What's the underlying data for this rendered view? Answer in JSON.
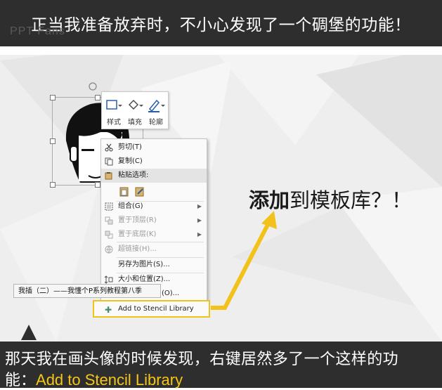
{
  "top_banner": {
    "title": "正当我准备放弃时，不小心发现了一个碉堡的功能！",
    "watermark": "PPT Fans"
  },
  "mini_toolbar": {
    "items": [
      {
        "label": "样式",
        "icon": "style-icon"
      },
      {
        "label": "填充",
        "icon": "fill-bucket-icon"
      },
      {
        "label": "轮廓",
        "icon": "outline-pen-icon"
      }
    ]
  },
  "context_menu": {
    "items": [
      {
        "label": "剪切(T)",
        "icon": "scissors-icon",
        "disabled": false
      },
      {
        "label": "复制(C)",
        "icon": "copy-icon",
        "disabled": false
      },
      {
        "label": "粘贴选项:",
        "icon": "paste-icon",
        "disabled": false,
        "header": true
      },
      {
        "label": "组合(G)",
        "icon": "group-icon",
        "disabled": false,
        "submenu": true
      },
      {
        "label": "置于顶层(R)",
        "icon": "bring-front-icon",
        "disabled": true,
        "submenu": true
      },
      {
        "label": "置于底层(K)",
        "icon": "send-back-icon",
        "disabled": true,
        "submenu": true
      },
      {
        "label": "超链接(H)...",
        "icon": "hyperlink-icon",
        "disabled": true
      },
      {
        "label": "另存为图片(S)...",
        "icon": "",
        "disabled": false
      },
      {
        "label": "大小和位置(Z)...",
        "icon": "size-position-icon",
        "disabled": false
      },
      {
        "label": "(O)...",
        "icon": "format-icon",
        "disabled": false
      }
    ],
    "stencil_item": {
      "label": "Add to Stencil Library",
      "icon": "plus-icon"
    }
  },
  "tooltip": "我插（二）——我懂个P系列教程第八季",
  "callout": {
    "bold": "添加",
    "rest": "到模板库？！"
  },
  "bottom_banner": {
    "line1": "那天我在画头像的时候发现，右键居然多了一个这样的功",
    "line2_prefix": "能：",
    "line2_highlight": "Add to Stencil Library"
  },
  "colors": {
    "banner_bg": "#2e2e2e",
    "highlight_yellow": "#f5c518",
    "arrow_yellow": "#f2c21a"
  }
}
